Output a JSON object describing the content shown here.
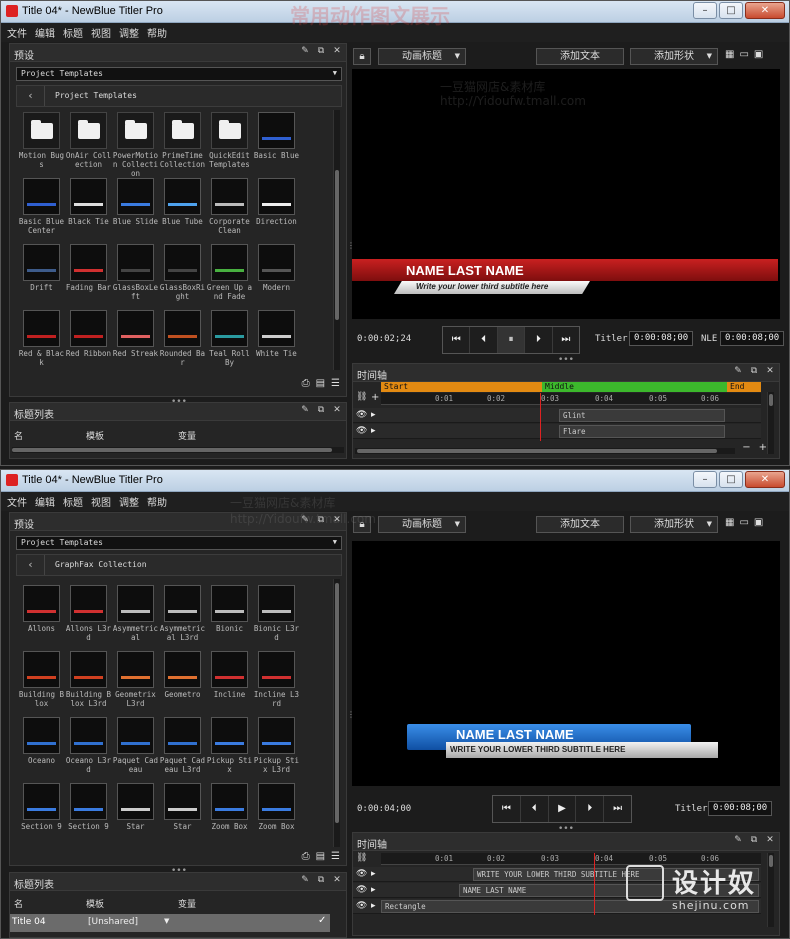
{
  "windows": [
    {
      "title": "Title 04* - NewBlue Titler Pro",
      "menu": [
        "文件",
        "编辑",
        "标题",
        "视图",
        "调整",
        "帮助"
      ],
      "presets_title": "预设",
      "dropdown": "Project Templates",
      "breadcrumb": "Project Templates",
      "tiles": [
        {
          "label": "Motion Bugs",
          "kind": "folder"
        },
        {
          "label": "OnAir Collection",
          "kind": "folder"
        },
        {
          "label": "PowerMotion Collection",
          "kind": "folder"
        },
        {
          "label": "PrimeTime Collection",
          "kind": "folder"
        },
        {
          "label": "QuickEdit Templates",
          "kind": "folder"
        },
        {
          "label": "Basic Blue",
          "kind": "thumb",
          "color": "#2f5fd0"
        },
        {
          "label": "Basic Blue Center",
          "kind": "thumb",
          "color": "#2f5fd0"
        },
        {
          "label": "Black Tie",
          "kind": "thumb",
          "color": "#dddddd"
        },
        {
          "label": "Blue Slide",
          "kind": "thumb",
          "color": "#3a7be0"
        },
        {
          "label": "Blue Tube",
          "kind": "thumb",
          "color": "#4ea2ee"
        },
        {
          "label": "Corporate Clean",
          "kind": "thumb",
          "color": "#bbbbbb"
        },
        {
          "label": "Direction",
          "kind": "thumb",
          "color": "#eeeeee"
        },
        {
          "label": "Drift",
          "kind": "thumb",
          "color": "#3d5b8a"
        },
        {
          "label": "Fading Bar",
          "kind": "thumb",
          "color": "#d03030"
        },
        {
          "label": "GlassBoxLeft",
          "kind": "thumb",
          "color": "#444444"
        },
        {
          "label": "GlassBoxRight",
          "kind": "thumb",
          "color": "#444444"
        },
        {
          "label": "Green Up and Fade",
          "kind": "thumb",
          "color": "#48b040"
        },
        {
          "label": "Modern",
          "kind": "thumb",
          "color": "#555555"
        },
        {
          "label": "Red & Black",
          "kind": "thumb",
          "color": "#c02020"
        },
        {
          "label": "Red Ribbon",
          "kind": "thumb",
          "color": "#c02020"
        },
        {
          "label": "Red Streak",
          "kind": "thumb",
          "color": "#e06060"
        },
        {
          "label": "Rounded Bar",
          "kind": "thumb",
          "color": "#c05020"
        },
        {
          "label": "Teal Roll By",
          "kind": "thumb",
          "color": "#2a9aa0"
        },
        {
          "label": "White Tie",
          "kind": "thumb",
          "color": "#cccccc"
        }
      ],
      "toolbar": {
        "preset_type": "动画标题",
        "add_text": "添加文本",
        "add_shape": "添加形状"
      },
      "lower_third": {
        "name": "NAME LAST NAME",
        "subtitle": "Write your lower third subtitle here"
      },
      "timecode": "0:00:02;24",
      "titler_label": "Titler",
      "titler_tc": "0:00:08;00",
      "nle_label": "NLE",
      "nle_tc": "0:00:08;00",
      "timeline_title": "时间轴",
      "segments": {
        "start": "Start",
        "middle": "Middle",
        "end": "End"
      },
      "ticks": [
        "0:01",
        "0:02",
        "0:03",
        "0:04",
        "0:05",
        "0:06"
      ],
      "tracks": [
        "Glint",
        "Flare"
      ],
      "titlelist_title": "标题列表",
      "columns": [
        "名",
        "模板",
        "变量"
      ],
      "rows": []
    },
    {
      "title": "Title 04* - NewBlue Titler Pro",
      "menu": [
        "文件",
        "编辑",
        "标题",
        "视图",
        "调整",
        "帮助"
      ],
      "presets_title": "预设",
      "dropdown": "Project Templates",
      "breadcrumb": "GraphFax Collection",
      "tiles": [
        {
          "label": "Allons",
          "kind": "thumb",
          "color": "#d03030"
        },
        {
          "label": "Allons L3rd",
          "kind": "thumb",
          "color": "#d03030"
        },
        {
          "label": "Asymmetrical",
          "kind": "thumb",
          "color": "#bbbbbb"
        },
        {
          "label": "Asymmetrical L3rd",
          "kind": "thumb",
          "color": "#bbbbbb"
        },
        {
          "label": "Bionic",
          "kind": "thumb",
          "color": "#bbbbbb"
        },
        {
          "label": "Bionic L3rd",
          "kind": "thumb",
          "color": "#bbbbbb"
        },
        {
          "label": "Building Blox",
          "kind": "thumb",
          "color": "#d04020"
        },
        {
          "label": "Building Blox L3rd",
          "kind": "thumb",
          "color": "#d04020"
        },
        {
          "label": "Geometrix L3rd",
          "kind": "thumb",
          "color": "#e07030"
        },
        {
          "label": "Geometro",
          "kind": "thumb",
          "color": "#e07030"
        },
        {
          "label": "Incline",
          "kind": "thumb",
          "color": "#d03030"
        },
        {
          "label": "Incline L3rd",
          "kind": "thumb",
          "color": "#d03030"
        },
        {
          "label": "Oceano",
          "kind": "thumb",
          "color": "#3070d0"
        },
        {
          "label": "Oceano L3rd",
          "kind": "thumb",
          "color": "#3070d0"
        },
        {
          "label": "Paquet Cadeau",
          "kind": "thumb",
          "color": "#3070d0"
        },
        {
          "label": "Paquet Cadeau L3rd",
          "kind": "thumb",
          "color": "#3070d0"
        },
        {
          "label": "Pickup Stix",
          "kind": "thumb",
          "color": "#3a7be0"
        },
        {
          "label": "Pickup Stix L3rd",
          "kind": "thumb",
          "color": "#3a7be0"
        },
        {
          "label": "Section 9",
          "kind": "thumb",
          "color": "#3a7be0"
        },
        {
          "label": "Section 9",
          "kind": "thumb",
          "color": "#3a7be0"
        },
        {
          "label": "Star",
          "kind": "thumb",
          "color": "#cccccc"
        },
        {
          "label": "Star",
          "kind": "thumb",
          "color": "#cccccc"
        },
        {
          "label": "Zoom Box",
          "kind": "thumb",
          "color": "#3a7be0"
        },
        {
          "label": "Zoom Box",
          "kind": "thumb",
          "color": "#3a7be0"
        }
      ],
      "toolbar": {
        "preset_type": "动画标题",
        "add_text": "添加文本",
        "add_shape": "添加形状"
      },
      "lower_third": {
        "name": "NAME LAST NAME",
        "subtitle": "WRITE YOUR LOWER THIRD SUBTITLE HERE"
      },
      "timecode": "0:00:04;00",
      "titler_label": "Titler",
      "titler_tc": "0:00:08;00",
      "timeline_title": "时间轴",
      "ticks": [
        "0:01",
        "0:02",
        "0:03",
        "0:04",
        "0:05",
        "0:06"
      ],
      "tracks": [
        "WRITE YOUR LOWER THIRD SUBTITLE HERE",
        "NAME LAST NAME",
        "Rectangle"
      ],
      "titlelist_title": "标题列表",
      "columns": [
        "名",
        "模板",
        "变量"
      ],
      "rows": [
        {
          "name": "Title 04",
          "template": "[Unshared]"
        }
      ]
    }
  ],
  "watermarks": {
    "banner": "常用动作图文展示",
    "shop": "一豆猫网店&素材库",
    "url": "http://Yidoufw.tmall.com"
  },
  "logo": {
    "text": "设计奴",
    "url": "shejinu.com"
  }
}
